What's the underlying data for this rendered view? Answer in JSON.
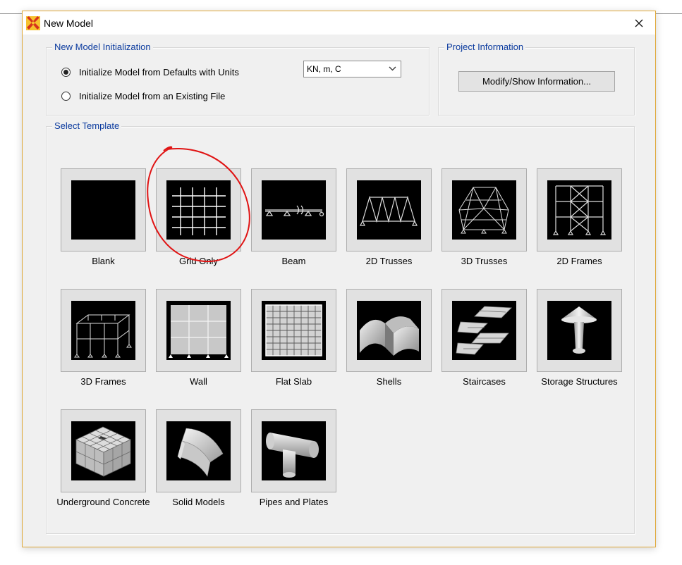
{
  "window": {
    "title": "New Model"
  },
  "init_group": {
    "legend": "New Model Initialization",
    "option_defaults": "Initialize Model from Defaults with Units",
    "option_existing": "Initialize Model  from an Existing File",
    "units_value": "KN, m, C",
    "selected": "defaults"
  },
  "project_group": {
    "legend": "Project Information",
    "button_label": "Modify/Show Information..."
  },
  "template_group": {
    "legend": "Select Template"
  },
  "templates": [
    {
      "label": "Blank",
      "icon": "blank-icon"
    },
    {
      "label": "Grid Only",
      "icon": "grid-only-icon"
    },
    {
      "label": "Beam",
      "icon": "beam-icon"
    },
    {
      "label": "2D Trusses",
      "icon": "2d-trusses-icon"
    },
    {
      "label": "3D Trusses",
      "icon": "3d-trusses-icon"
    },
    {
      "label": "2D Frames",
      "icon": "2d-frames-icon"
    },
    {
      "label": "3D Frames",
      "icon": "3d-frames-icon"
    },
    {
      "label": "Wall",
      "icon": "wall-icon"
    },
    {
      "label": "Flat Slab",
      "icon": "flat-slab-icon"
    },
    {
      "label": "Shells",
      "icon": "shells-icon"
    },
    {
      "label": "Staircases",
      "icon": "staircases-icon"
    },
    {
      "label": "Storage Structures",
      "icon": "storage-structures-icon"
    },
    {
      "label": "Underground Concrete",
      "icon": "underground-concrete-icon"
    },
    {
      "label": "Solid Models",
      "icon": "solid-models-icon"
    },
    {
      "label": "Pipes and Plates",
      "icon": "pipes-and-plates-icon"
    }
  ],
  "colors": {
    "legend_text": "#0a3a9e",
    "annotation": "#e01414",
    "window_border": "#e0a93a"
  }
}
